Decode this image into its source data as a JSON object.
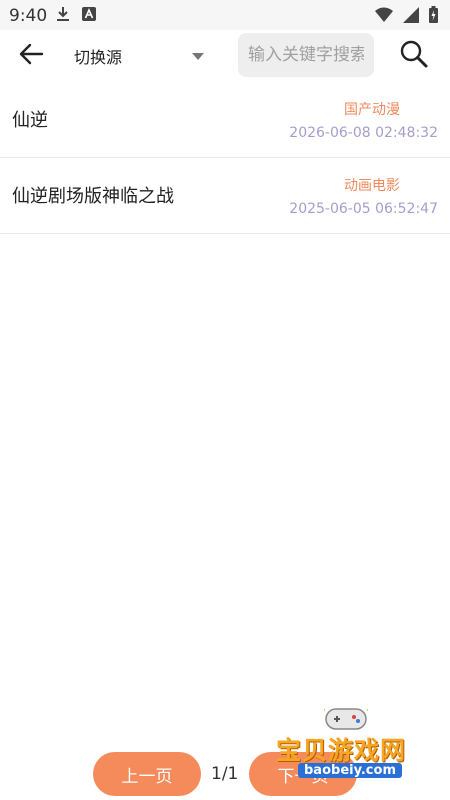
{
  "status_bar": {
    "time": "9:40"
  },
  "toolbar": {
    "source_label": "切换源",
    "search_placeholder": "输入关键字搜索"
  },
  "results": [
    {
      "title": "仙逆",
      "category": "国产动漫",
      "date": "2026-06-08 02:48:32"
    },
    {
      "title": "仙逆剧场版神临之战",
      "category": "动画电影",
      "date": "2025-06-05 06:52:47"
    }
  ],
  "pager": {
    "prev_label": "上一页",
    "page_indicator": "1/1",
    "next_label": "下一页"
  },
  "watermark": {
    "text": "宝贝游戏网",
    "url": "baobeiy.com"
  },
  "colors": {
    "accent": "#f58a5a",
    "category": "#f08a5d",
    "date": "#a89ccc"
  }
}
